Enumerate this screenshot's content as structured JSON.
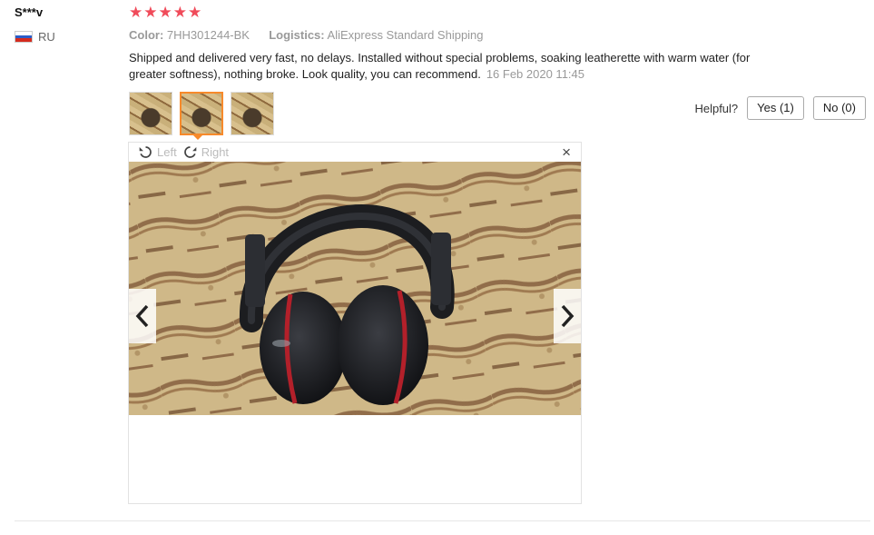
{
  "reviewer": {
    "name": "S***v",
    "country_code": "RU"
  },
  "rating": {
    "stars": 5,
    "max": 5,
    "color": "#f04b5a"
  },
  "meta": {
    "color_label": "Color:",
    "color_value": "7HH301244-BK",
    "logistics_label": "Logistics:",
    "logistics_value": "AliExpress Standard Shipping"
  },
  "review": {
    "text": "Shipped and delivered very fast, no delays. Installed without special problems, soaking leatherette with warm water (for greater softness), nothing broke. Look quality, you can recommend.",
    "date": "16 Feb 2020 11:45"
  },
  "thumbnails": [
    {
      "id": "t1",
      "active": false
    },
    {
      "id": "t2",
      "active": true
    },
    {
      "id": "t3",
      "active": false
    }
  ],
  "helpful": {
    "label": "Helpful?",
    "yes_label": "Yes (1)",
    "no_label": "No (0)"
  },
  "viewer": {
    "rotate_left_label": "Left",
    "rotate_right_label": "Right",
    "close_icon": "×",
    "accent": "#f78a2b"
  }
}
